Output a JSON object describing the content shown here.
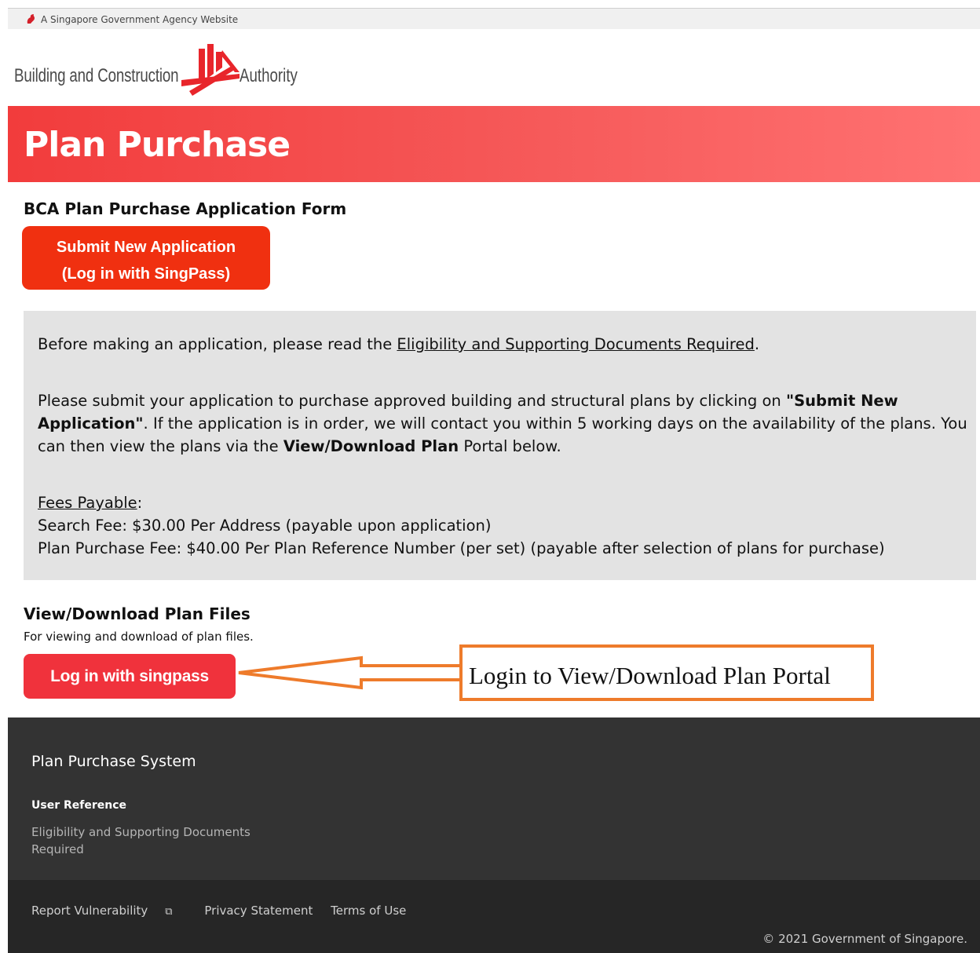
{
  "masthead": {
    "text": "A Singapore Government Agency Website"
  },
  "logo": {
    "left_text": "Building and Construction",
    "right_text": "Authority"
  },
  "banner": {
    "title": "Plan Purchase"
  },
  "form": {
    "title": "BCA Plan Purchase Application Form",
    "submit_line1": "Submit New Application",
    "submit_line2": "(Log in with SingPass)"
  },
  "info": {
    "p1_prefix": "Before making an application, please read the ",
    "p1_link": "Eligibility and Supporting Documents Required",
    "p1_suffix": ".",
    "p2_a": "Please submit your application to purchase approved building and structural plans by clicking on ",
    "p2_b_bold": "\"Submit New Application\"",
    "p2_c": ". If the application is in order, we will contact you within 5 working days on the availability of the plans. You can then view the plans via the ",
    "p2_d_bold": "View/Download Plan",
    "p2_e": " Portal below.",
    "fees_label": "Fees Payable",
    "fees_colon": ":",
    "fee_search": "Search Fee: $30.00 Per Address (payable upon application)",
    "fee_plan": "Plan Purchase Fee: $40.00 Per Plan Reference Number (per set) (payable after selection of plans for purchase)"
  },
  "view": {
    "title": "View/Download Plan Files",
    "subtitle": "For viewing and download of plan files.",
    "login_button": "Log in with singpass"
  },
  "annotation": {
    "text": "Login to View/Download Plan Portal",
    "color": "#ee7b2b"
  },
  "footer": {
    "title": "Plan Purchase System",
    "user_ref": "User Reference",
    "link": "Eligibility and Supporting Documents Required"
  },
  "subfooter": {
    "report": "Report Vulnerability",
    "privacy": "Privacy Statement",
    "terms": "Terms of Use",
    "copyright": "© 2021 Government of Singapore."
  },
  "colors": {
    "banner_start": "#f23c3c",
    "banner_end": "#ff7272",
    "submit_button": "#f03010",
    "singpass_button": "#f0323c",
    "footer_bg": "#333333",
    "subfooter_bg": "#262626",
    "info_bg": "#e3e3e3"
  }
}
